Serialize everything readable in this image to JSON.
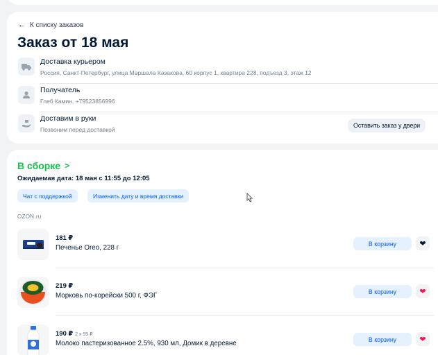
{
  "header": {
    "back_label": "К списку заказов",
    "title": "Заказ от 18 мая"
  },
  "delivery": {
    "courier_title": "Доставка курьером",
    "courier_address": "Россия, Санкт-Петербург, улица Маршала Казакова, 60 корпус 1, квартира 228, подъезд 3, этаж 12",
    "recipient_title": "Получатель",
    "recipient_info": "Глеб Камин, +79523856996",
    "handover_title": "Доставим в руки",
    "handover_info": "Позвоним перед доставкой",
    "leave_at_door_label": "Оставить заказ у двери"
  },
  "shipment": {
    "status_label": "В сборке",
    "expected_date": "Ожидаемая дата: 18 мая с 11:55 до 12:05",
    "support_chat_label": "Чат с поддержкой",
    "change_date_label": "Изменить дату и время доставки",
    "seller": "OZON.ru",
    "status_color": "#10c44c"
  },
  "items": [
    {
      "price": "181 ₽",
      "price_sub": "",
      "name": "Печенье Oreo, 228 г",
      "cart_label": "В корзину",
      "favorite_color": "#001a34",
      "image_icon": "oreo-package"
    },
    {
      "price": "219 ₽",
      "price_sub": "",
      "name": "Морковь по-корейски 500 г, ФЭГ",
      "cart_label": "В корзину",
      "favorite_color": "#f91155",
      "image_icon": "carrot-salad-container"
    },
    {
      "price": "190 ₽",
      "price_sub": "2 х 95 ₽",
      "name": "Молоко пастеризованное 2.5%, 930 мл, Домик в деревне",
      "cart_label": "В корзину",
      "favorite_color": "#f91155",
      "image_icon": "milk-bottle"
    }
  ],
  "colors": {
    "accent": "#005bff",
    "accent_bg": "#e5f1fe",
    "page_bg": "#f2f3f5"
  }
}
